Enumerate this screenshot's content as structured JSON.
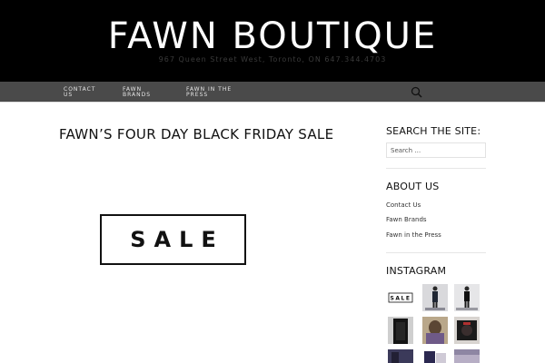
{
  "header": {
    "title": "FAWN BOUTIQUE",
    "description": "967 Queen Street West, Toronto, ON 647.344.4703"
  },
  "nav": {
    "items": [
      {
        "line1": "CONTACT",
        "line2": "US"
      },
      {
        "line1": "FAWN",
        "line2": "BRANDS"
      },
      {
        "line1": "FAWN IN THE",
        "line2": "PRESS"
      }
    ],
    "search_icon": "search-icon"
  },
  "post": {
    "title": "FAWN’S FOUR DAY BLACK FRIDAY SALE",
    "image_text": "SALE"
  },
  "sidebar": {
    "search_title": "SEARCH THE SITE:",
    "search_placeholder": "Search …",
    "about_title": "ABOUT US",
    "links": [
      "Contact Us",
      "Fawn Brands",
      "Fawn in the Press"
    ],
    "instagram_title": "INSTAGRAM",
    "instagram_sale_text": "SALE"
  },
  "colors": {
    "header_bg": "#000000",
    "nav_bg": "#4a4a4a",
    "text": "#111111"
  }
}
